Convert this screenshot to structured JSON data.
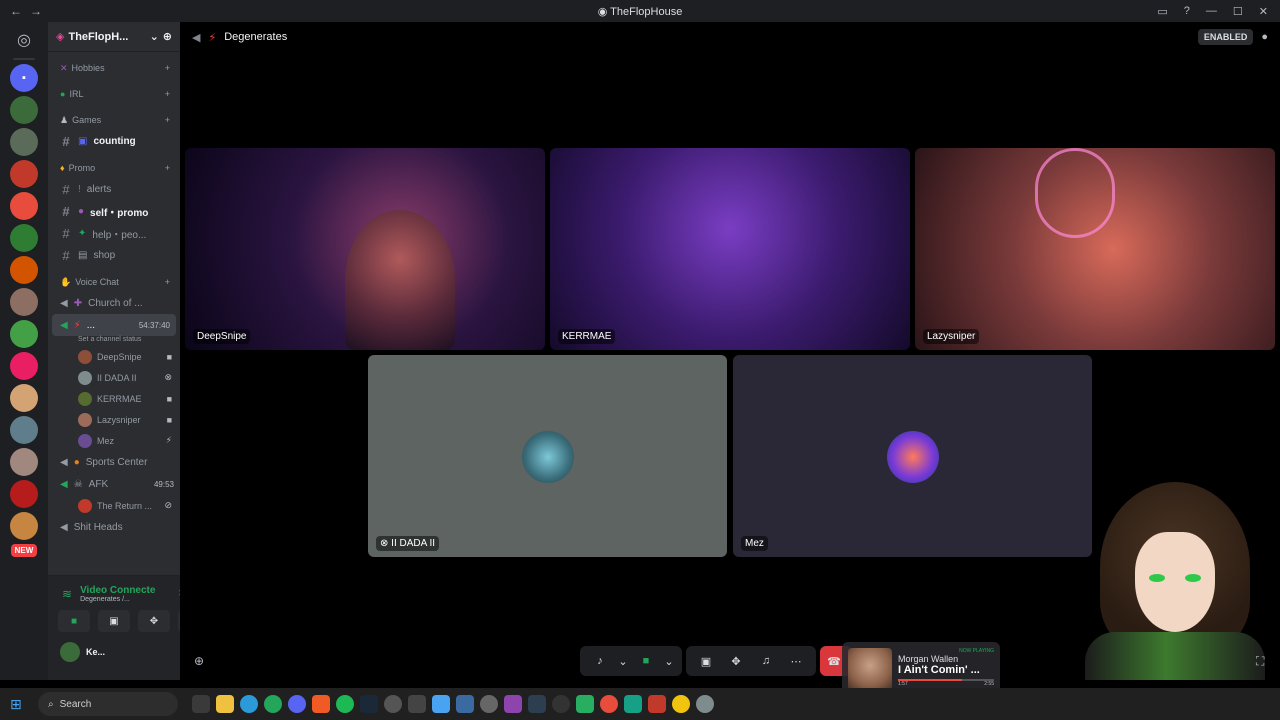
{
  "window": {
    "title": "TheFlopHouse"
  },
  "server": {
    "name": "TheFlopH..."
  },
  "categories": {
    "hobbies": "Hobbies",
    "irl": "IRL",
    "games": "Games",
    "promo": "Promo",
    "voice": "Voice Chat"
  },
  "channels": {
    "counting": "counting",
    "alerts": "alerts",
    "self_promo": "self・promo",
    "help": "help・peo...",
    "shop": "shop",
    "church": "Church of ...",
    "active_voice": "...",
    "active_voice_time": "54:37:40",
    "channel_status": "Set a channel status",
    "sports": "Sports Center",
    "afk": "AFK",
    "afk_time": "49:53",
    "return": "The Return ...",
    "shit_heads": "Shit Heads"
  },
  "voice_users": [
    "DeepSnipe",
    "II DADA II",
    "KERRMAE",
    "Lazysniper",
    "Mez"
  ],
  "voice_panel": {
    "title": "Video Connecte",
    "subtitle": "Degenerates /...",
    "user": "Ke..."
  },
  "guild_new_badge": "NEW",
  "topbar": {
    "channel": "Degenerates",
    "enabled": "ENABLED"
  },
  "tiles": {
    "deepsnipe": "DeepSnipe",
    "kerrmae": "KERRMAE",
    "lazysniper": "Lazysniper",
    "dada": "II DADA II",
    "mez": "Mez"
  },
  "now_playing": {
    "tag": "NOW PLAYING",
    "artist": "Morgan Wallen",
    "track": "I Ain't Comin' ...",
    "elapsed": "1:57",
    "duration": "2:55",
    "progress": 0.67
  },
  "taskbar": {
    "search": "Search"
  },
  "colors": {
    "accent": "#5865f2",
    "online": "#23a55a",
    "danger": "#da373c"
  }
}
